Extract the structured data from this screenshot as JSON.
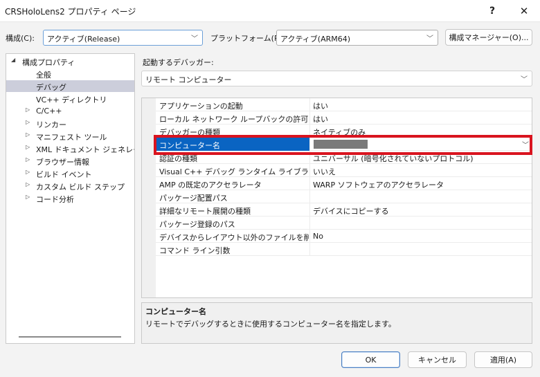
{
  "window": {
    "title": "CRSHoloLens2 プロパティ ページ",
    "help_label": "?",
    "close_label": "✕"
  },
  "toolbar": {
    "config_label": "構成(C):",
    "config_value": "アクティブ(Release)",
    "platform_label": "プラットフォーム(P):",
    "platform_value": "アクティブ(ARM64)",
    "config_manager_label": "構成マネージャー(O)..."
  },
  "tree": {
    "items": [
      {
        "label": "構成プロパティ",
        "arrow": "◢"
      },
      {
        "label": "全般",
        "arrow": ""
      },
      {
        "label": "デバッグ",
        "arrow": "",
        "selected": true
      },
      {
        "label": "VC++ ディレクトリ",
        "arrow": ""
      },
      {
        "label": "C/C++",
        "arrow": "▷"
      },
      {
        "label": "リンカー",
        "arrow": "▷"
      },
      {
        "label": "マニフェスト ツール",
        "arrow": "▷"
      },
      {
        "label": "XML ドキュメント ジェネレーター",
        "arrow": "▷"
      },
      {
        "label": "ブラウザー情報",
        "arrow": "▷"
      },
      {
        "label": "ビルド イベント",
        "arrow": "▷"
      },
      {
        "label": "カスタム ビルド ステップ",
        "arrow": "▷"
      },
      {
        "label": "コード分析",
        "arrow": "▷"
      }
    ]
  },
  "debugger": {
    "label": "起動するデバッガー:",
    "value": "リモート コンピューター"
  },
  "grid": {
    "rows": [
      {
        "name": "アプリケーションの起動",
        "value": "はい"
      },
      {
        "name": "ローカル ネットワーク ループバックの許可",
        "value": "はい"
      },
      {
        "name": "デバッガーの種類",
        "value": "ネイティブのみ"
      },
      {
        "name": "コンピューター名",
        "value": ""
      },
      {
        "name": "認証の種類",
        "value": "ユニバーサル (暗号化されていないプロトコル)"
      },
      {
        "name": "Visual C++ デバッグ ランタイム ライブラリの配置",
        "value": "いいえ"
      },
      {
        "name": "AMP の既定のアクセラレータ",
        "value": "WARP ソフトウェアのアクセラレータ"
      },
      {
        "name": "パッケージ配置パス",
        "value": ""
      },
      {
        "name": "詳細なリモート展開の種類",
        "value": "デバイスにコピーする"
      },
      {
        "name": "パッケージ登録のパス",
        "value": ""
      },
      {
        "name": "デバイスからレイアウト以外のファイルを削除する",
        "value": "No"
      },
      {
        "name": "コマンド ライン引数",
        "value": ""
      }
    ]
  },
  "description": {
    "title": "コンピューター名",
    "text": "リモートでデバッグするときに使用するコンピューター名を指定します。"
  },
  "footer": {
    "ok_label": "OK",
    "cancel_label": "キャンセル",
    "apply_label": "適用(A)"
  },
  "colors": {
    "selection": "#0a64c2",
    "highlight_box": "#d9141f",
    "tree_selected": "#cccedb"
  }
}
